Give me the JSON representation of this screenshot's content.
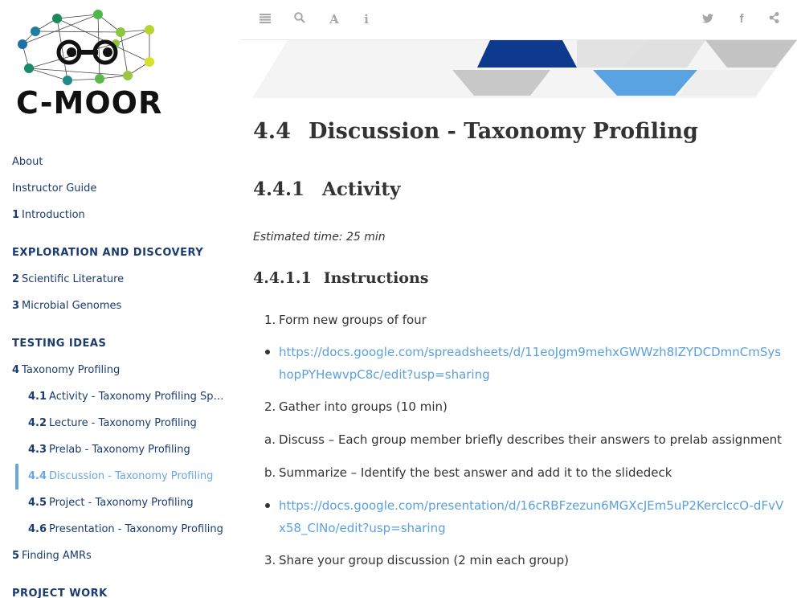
{
  "logo": {
    "text": "C-MOOR"
  },
  "sidebar": {
    "items": [
      {
        "num": "",
        "label": "About"
      },
      {
        "num": "",
        "label": "Instructor Guide"
      },
      {
        "num": "1",
        "label": "Introduction"
      }
    ],
    "part1": "EXPLORATION AND DISCOVERY",
    "part1_items": [
      {
        "num": "2",
        "label": "Scientific Literature"
      },
      {
        "num": "3",
        "label": "Microbial Genomes"
      }
    ],
    "part2": "TESTING IDEAS",
    "part2_items": [
      {
        "num": "4",
        "label": "Taxonomy Profiling"
      }
    ],
    "sub_items": [
      {
        "num": "4.1",
        "label": "Activity - Taxonomy Profiling Spre..."
      },
      {
        "num": "4.2",
        "label": "Lecture - Taxonomy Profiling"
      },
      {
        "num": "4.3",
        "label": "Prelab - Taxonomy Profiling"
      },
      {
        "num": "4.4",
        "label": "Discussion - Taxonomy Profiling"
      },
      {
        "num": "4.5",
        "label": "Project - Taxonomy Profiling"
      },
      {
        "num": "4.6",
        "label": "Presentation - Taxonomy Profiling"
      }
    ],
    "after_items": [
      {
        "num": "5",
        "label": "Finding AMRs"
      }
    ],
    "part3": "PROJECT WORK"
  },
  "toolbar": {
    "left": [
      "menu-icon",
      "search-icon",
      "font-icon",
      "info-icon"
    ],
    "right": [
      "twitter-icon",
      "facebook-icon",
      "share-icon"
    ]
  },
  "content": {
    "h1_num": "4.4",
    "h1_title": "Discussion - Taxonomy Profiling",
    "h2_num": "4.4.1",
    "h2_title": "Activity",
    "estimated": "Estimated time: 25 min",
    "h3_num": "4.4.1.1",
    "h3_title": "Instructions",
    "step1": "Form new groups of four",
    "link1": "https://docs.google.com/spreadsheets/d/11eoJgm9mehxGWWzh8IZYDCDmnCmSyshopPYHewvpC8c/edit?usp=sharing",
    "step2": "Gather into groups (10 min)",
    "step2a": "Discuss – Each group member briefly describes their answers to prelab assignment",
    "step2b": "Summarize – Identify the best answer and add it to the slidedeck",
    "link2": "https://docs.google.com/presentation/d/16cRBFzezun6MGXcJEm5uP2KercIccO-dFvVx58_ClNo/edit?usp=sharing",
    "step3": "Share your group discussion (2 min each group)",
    "markers": {
      "m1": "1.",
      "m2": "2.",
      "ma": "a.",
      "mb": "b.",
      "m3": "3."
    }
  },
  "colors": {
    "navy": "#1b3b6f",
    "accent": "#6aa6df",
    "link": "#5aa0de"
  }
}
